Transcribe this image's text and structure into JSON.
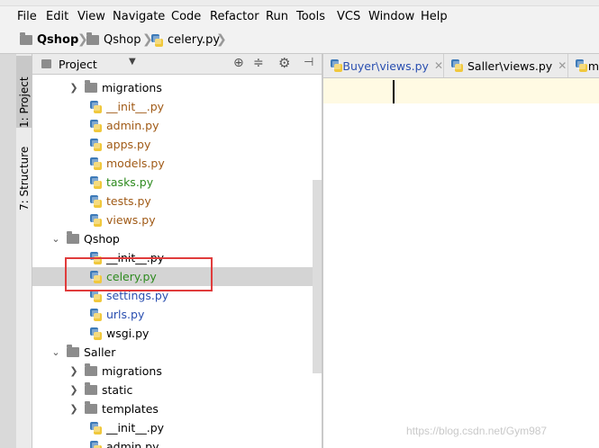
{
  "menu": [
    "File",
    "Edit",
    "View",
    "Navigate",
    "Code",
    "Refactor",
    "Run",
    "Tools",
    "VCS",
    "Window",
    "Help"
  ],
  "breadcrumb": [
    "Qshop",
    "Qshop",
    "celery.py"
  ],
  "left_tabs": [
    "1: Project",
    "7: Structure"
  ],
  "panel": {
    "title": "Project"
  },
  "editor_tabs": [
    {
      "label": "Buyer\\views.py"
    },
    {
      "label": "Saller\\views.py"
    },
    {
      "label": "m"
    }
  ],
  "tree": [
    {
      "label": "migrations",
      "type": "folder",
      "expanded": false,
      "color": "#000000"
    },
    {
      "label": "__init__.py",
      "type": "py",
      "color": "#a05a16"
    },
    {
      "label": "admin.py",
      "type": "py",
      "color": "#a05a16"
    },
    {
      "label": "apps.py",
      "type": "py",
      "color": "#a05a16"
    },
    {
      "label": "models.py",
      "type": "py",
      "color": "#a05a16"
    },
    {
      "label": "tasks.py",
      "type": "py",
      "color": "#2e8b1f"
    },
    {
      "label": "tests.py",
      "type": "py",
      "color": "#a05a16"
    },
    {
      "label": "views.py",
      "type": "py",
      "color": "#a05a16"
    },
    {
      "label": "Qshop",
      "type": "folder",
      "expanded": true,
      "color": "#000000"
    },
    {
      "label": "__init__.py",
      "type": "py",
      "color": "#000000"
    },
    {
      "label": "celery.py",
      "type": "py",
      "color": "#2e8b1f",
      "selected": true
    },
    {
      "label": "settings.py",
      "type": "py",
      "color": "#2a4fb0"
    },
    {
      "label": "urls.py",
      "type": "py",
      "color": "#2a4fb0"
    },
    {
      "label": "wsgi.py",
      "type": "py",
      "color": "#000000"
    },
    {
      "label": "Saller",
      "type": "folder",
      "expanded": true,
      "color": "#000000"
    },
    {
      "label": "migrations",
      "type": "folder",
      "expanded": false,
      "color": "#000000"
    },
    {
      "label": "static",
      "type": "folder",
      "expanded": false,
      "color": "#000000"
    },
    {
      "label": "templates",
      "type": "folder",
      "expanded": false,
      "color": "#000000"
    },
    {
      "label": "__init__.py",
      "type": "py",
      "color": "#000000"
    },
    {
      "label": "admin.py",
      "type": "py",
      "color": "#000000"
    }
  ],
  "watermark": "https://blog.csdn.net/Gym987"
}
